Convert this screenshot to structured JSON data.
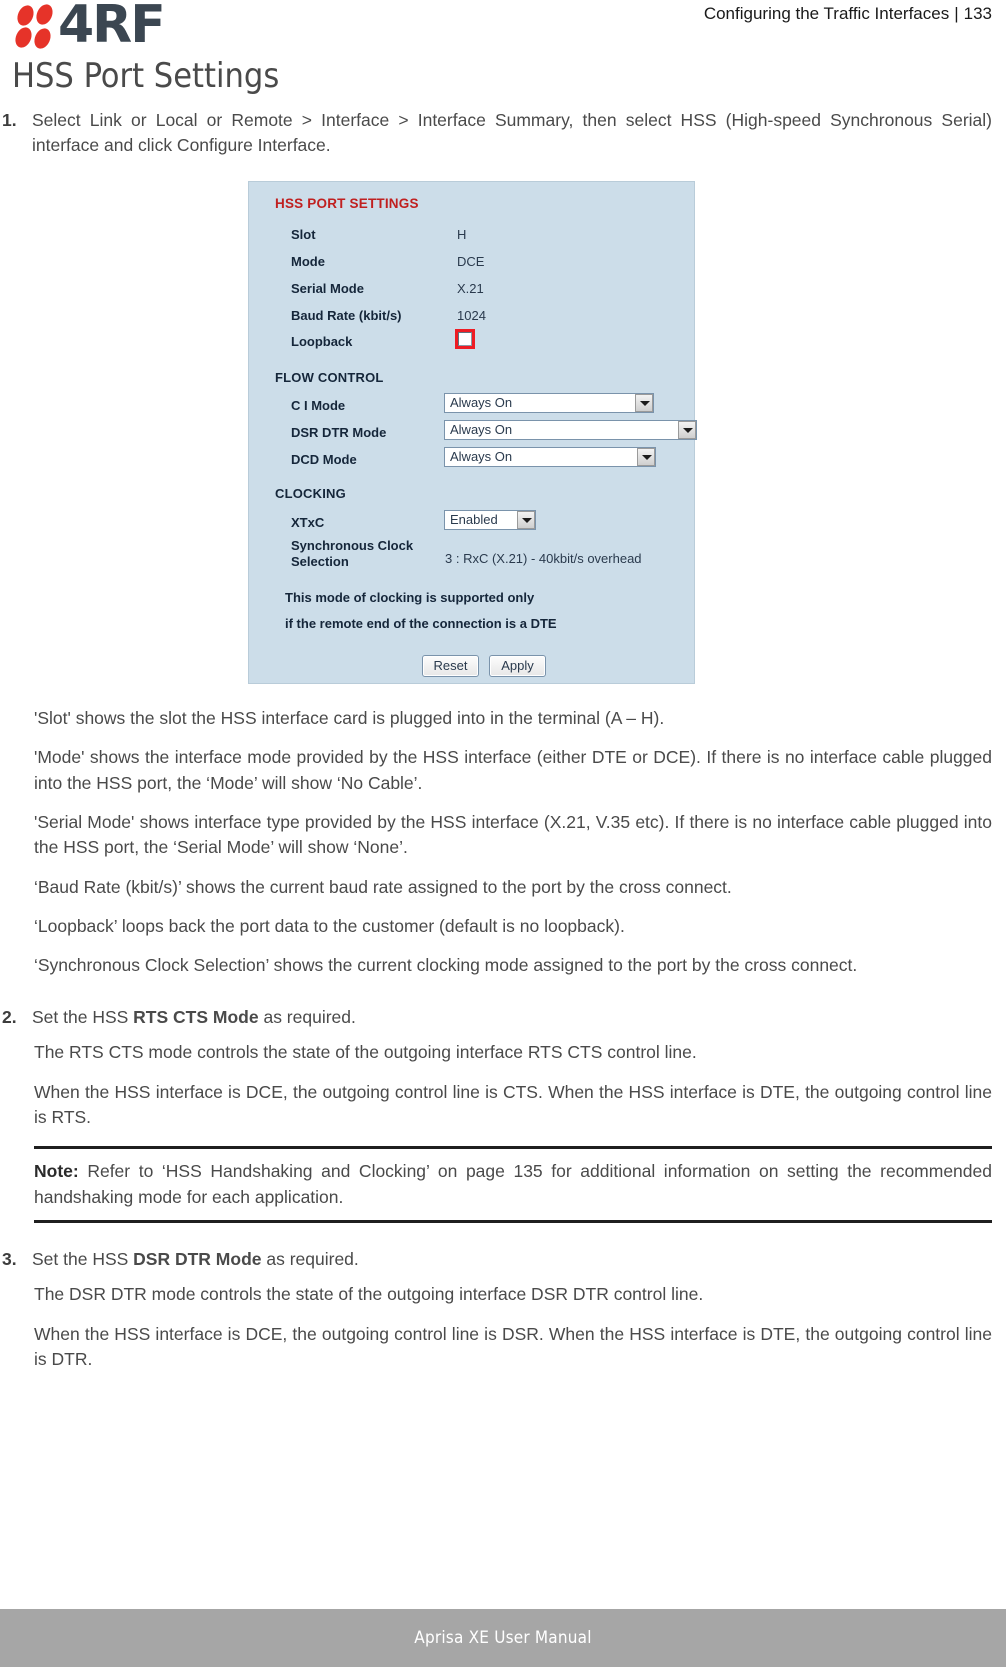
{
  "header": {
    "logo_text": "4RF",
    "breadcrumb": "Configuring the Traffic Interfaces",
    "separator": "|",
    "page_number": "133"
  },
  "page_title": "HSS Port Settings",
  "steps": {
    "step1": {
      "number": "1.",
      "text": "Select Link or Local or Remote > Interface > Interface Summary, then select HSS (High-speed Synchronous Serial) interface and click Configure Interface."
    },
    "step2": {
      "number": "2.",
      "text_prefix": "Set the HSS ",
      "text_bold": "RTS CTS Mode",
      "text_suffix": " as required.",
      "para1": "The RTS CTS mode controls the state of the outgoing interface RTS CTS control line.",
      "para2": "When the HSS interface is DCE, the outgoing control line is CTS.  When the HSS interface is DTE, the outgoing control line is RTS."
    },
    "step3": {
      "number": "3.",
      "text_prefix": "Set the HSS ",
      "text_bold": "DSR DTR Mode",
      "text_suffix": " as required.",
      "para1": "The DSR DTR mode controls the state of the outgoing interface DSR DTR control line.",
      "para2": "When the HSS interface is DCE, the outgoing control line is DSR. When the HSS interface is DTE, the outgoing control line is DTR."
    }
  },
  "descriptions": [
    "'Slot' shows the slot the HSS interface card is plugged into in the terminal (A – H).",
    "'Mode' shows the interface mode provided by the HSS interface (either DTE or DCE). If there is no interface cable plugged into the HSS port, the ‘Mode’ will show ‘No Cable’.",
    "'Serial Mode' shows interface type provided by the HSS interface (X.21, V.35 etc). If there is no interface cable plugged into the HSS port, the ‘Serial Mode’ will show ‘None’.",
    "‘Baud Rate (kbit/s)’ shows the current baud rate assigned to the port by the cross connect.",
    "‘Loopback’ loops back the port data to the customer (default is no loopback).",
    "‘Synchronous Clock Selection’ shows the current clocking mode assigned to the port by the cross connect."
  ],
  "note": {
    "label": "Note:",
    "text": " Refer to ‘HSS Handshaking and Clocking’ on page 135 for additional information on setting the recommended handshaking mode for each application."
  },
  "screenshot": {
    "title": "HSS PORT SETTINGS",
    "fields": [
      {
        "label": "Slot",
        "value": "H"
      },
      {
        "label": "Mode",
        "value": "DCE"
      },
      {
        "label": "Serial Mode",
        "value": "X.21"
      },
      {
        "label": "Baud Rate (kbit/s)",
        "value": "1024"
      },
      {
        "label": "Loopback",
        "value": ""
      }
    ],
    "loopback": {
      "label": "Loopback",
      "checked": false
    },
    "flow_control": {
      "title": "FLOW CONTROL",
      "rows": [
        {
          "label": "C I Mode",
          "value": "Always On"
        },
        {
          "label": "DSR DTR Mode",
          "value": "Always On"
        },
        {
          "label": "DCD Mode",
          "value": "Always On"
        }
      ]
    },
    "clocking": {
      "title": "CLOCKING",
      "xtxc_label": "XTxC",
      "xtxc_value": "Enabled",
      "sync_label_line1": "Synchronous Clock",
      "sync_label_line2": "Selection",
      "sync_value": "3 : RxC (X.21) - 40kbit/s overhead",
      "note_line1": "This mode of clocking is supported only",
      "note_line2": "if the remote end of the connection is a DTE"
    },
    "buttons": {
      "reset": "Reset",
      "apply": "Apply"
    },
    "colors": {
      "panel_bg": "#ccdde9",
      "title_red": "#c02020",
      "highlight_red": "#ee1c24",
      "label_text": "#15263a"
    }
  },
  "footer": {
    "text": "Aprisa XE User Manual"
  }
}
